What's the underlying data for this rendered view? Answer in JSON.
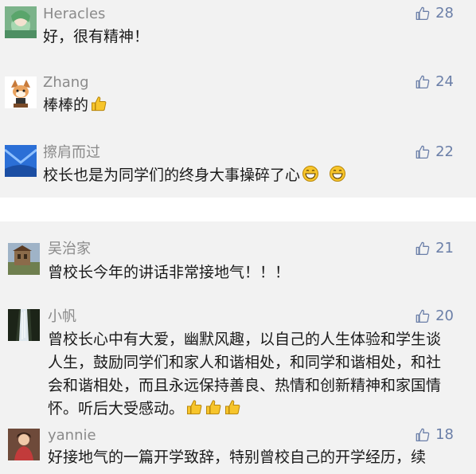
{
  "comments_top": [
    {
      "name": "Heracles",
      "text": "好，很有精神！",
      "likes": "28",
      "avatar": "anime-girl-avatar"
    },
    {
      "name": "Zhang",
      "text": "棒棒的",
      "likes": "24",
      "avatar": "cartoon-character-avatar",
      "emoji": [
        "thumbs-up"
      ]
    },
    {
      "name": "擦肩而过",
      "text": "校长也是为同学们的终身大事操碎了心",
      "likes": "22",
      "avatar": "blue-abstract-avatar",
      "emoji": [
        "grin",
        "grin"
      ]
    }
  ],
  "comments_bottom": [
    {
      "name": "吴治家",
      "text": "曾校长今年的讲话非常接地气！！！",
      "likes": "21",
      "avatar": "building-photo-avatar"
    },
    {
      "name": "小帆",
      "text": "曾校长心中有大爱，幽默风趣，以自己的人生体验和学生谈人生，鼓励同学们和家人和谐相处，和同学和谐相处，和社会和谐相处，而且永远保持善良、热情和创新精神和家国情怀。听后大受感动。",
      "likes": "20",
      "avatar": "waterfall-photo-avatar",
      "emoji": [
        "thumbs-up",
        "thumbs-up",
        "thumbs-up"
      ]
    },
    {
      "name": "yannie",
      "text": "好接地气的一篇开学致辞，特别曾校自己的开学经历，续",
      "likes": "18",
      "avatar": "portrait-photo-avatar"
    }
  ],
  "colors": {
    "background": "#f2f2f2",
    "name": "#8a8a8a",
    "like": "#6b7fa8",
    "text": "#1a1a1a"
  },
  "icons": {
    "like": "thumbs-up-outline-icon"
  }
}
